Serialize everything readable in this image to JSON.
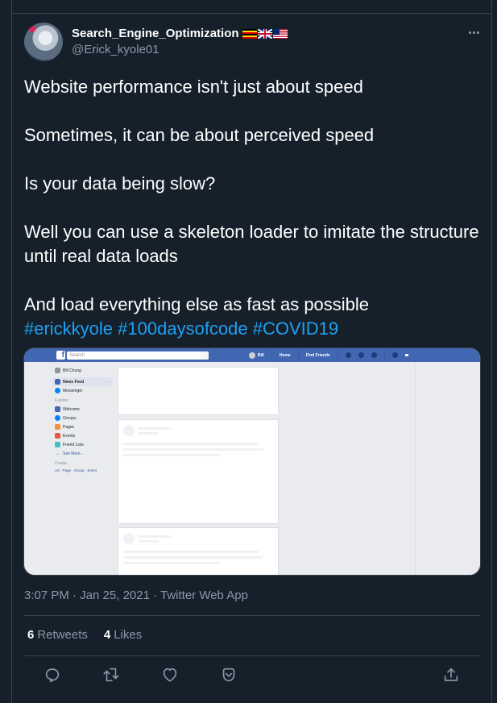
{
  "author": {
    "display_name": "Search_Engine_Optimization",
    "flags": [
      "uganda-flag",
      "uk-flag",
      "liberia-flag"
    ],
    "handle": "@Erick_kyole01"
  },
  "tweet": {
    "paragraphs": [
      "Website performance isn't just about speed",
      "Sometimes, it can be about perceived speed",
      "Is your data being slow?",
      "Well you can use a skeleton loader to imitate the structure until real data loads",
      "And load everything else as fast as possible"
    ],
    "hashtags": [
      "#erickkyole",
      "#100daysofcode",
      "#COVID19"
    ]
  },
  "media": {
    "search_placeholder": "Search",
    "nav": {
      "user": "Bill",
      "home": "Home",
      "find_friends": "Find Friends"
    },
    "sidebar": {
      "profile": "Bill Chung",
      "news_feed": "News Feed",
      "messenger": "Messenger",
      "explore_heading": "Explore",
      "explore_items": [
        "Welcome",
        "Groups",
        "Pages",
        "Events",
        "Friend Lists"
      ],
      "see_more": "See More...",
      "create_heading": "Create",
      "create_links": "Ad · Page · Group · Event"
    }
  },
  "meta": {
    "time": "3:07 PM · Jan 25, 2021 · Twitter Web App"
  },
  "stats": {
    "retweets_count": "6",
    "retweets_label": "Retweets",
    "likes_count": "4",
    "likes_label": "Likes"
  },
  "actions": [
    "reply-icon",
    "retweet-icon",
    "like-icon",
    "share-dm-icon",
    "share-icon"
  ],
  "colors": {
    "background": "#15202b",
    "secondary_text": "#8899a6",
    "accent": "#1da1f2",
    "border": "#38444d",
    "facebook_blue": "#4267b2"
  }
}
